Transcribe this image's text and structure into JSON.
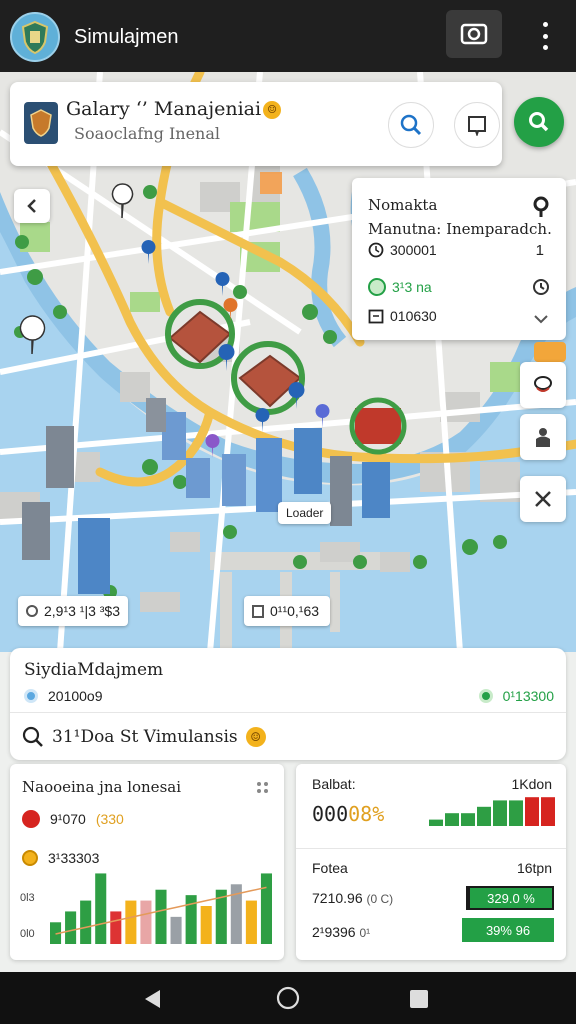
{
  "app": {
    "title": "Simulajmen"
  },
  "search": {
    "title": "Galary ‘’ Manajeniai",
    "subtitle": "Soaoclafng Inenal"
  },
  "info_card": {
    "title": "Nomakta",
    "subtitle": "Manutna: Inemparadch.",
    "row1_value": "300001",
    "row1_right": "1",
    "row2_value": "3¹3 na",
    "row3_value": "010630"
  },
  "map_labels": {
    "left_chip": "2,9¹3 ¹|3 ³$3",
    "center_chip": "0¹¹0,¹63",
    "building_label": "Loader"
  },
  "summary": {
    "title": "SiydiaMdajmem",
    "left_value": "20100o9",
    "right_value": "0¹13300",
    "search_text": "31¹Doa St Vimulansis"
  },
  "card_left": {
    "title": "Naooeina jna lonesai",
    "legend1_value": "9¹070",
    "legend1_extra": "(330",
    "legend2_value": "3¹33303",
    "ytick_top": "0l3",
    "ytick_bottom": "0l0",
    "bar_values": [
      2,
      3,
      4,
      6.5,
      3,
      4,
      4,
      5,
      2.5,
      4.5,
      3.5,
      5,
      5.5,
      4,
      6.5
    ]
  },
  "card_right": {
    "label1": "Balbat:",
    "right1": "1Kdon",
    "value1_a": "000",
    "value1_b": "08%",
    "label2": "Fotea",
    "right2": "16tpn",
    "value2": "7210.96",
    "value2_suffix": "(0 C)",
    "value3": "2¹9396",
    "value3_suffix": "0¹",
    "badge1": "329.0 %",
    "badge2": "39% 96",
    "mini_bars": [
      1,
      2,
      2,
      3,
      4,
      4,
      4.5,
      4.5
    ]
  },
  "colors": {
    "accent_green": "#23a046",
    "bar_colors": [
      "#2e9e44",
      "#f3b21c",
      "#d33",
      "#e8a6a6",
      "#9aa0a6",
      "#2e78c5"
    ]
  }
}
